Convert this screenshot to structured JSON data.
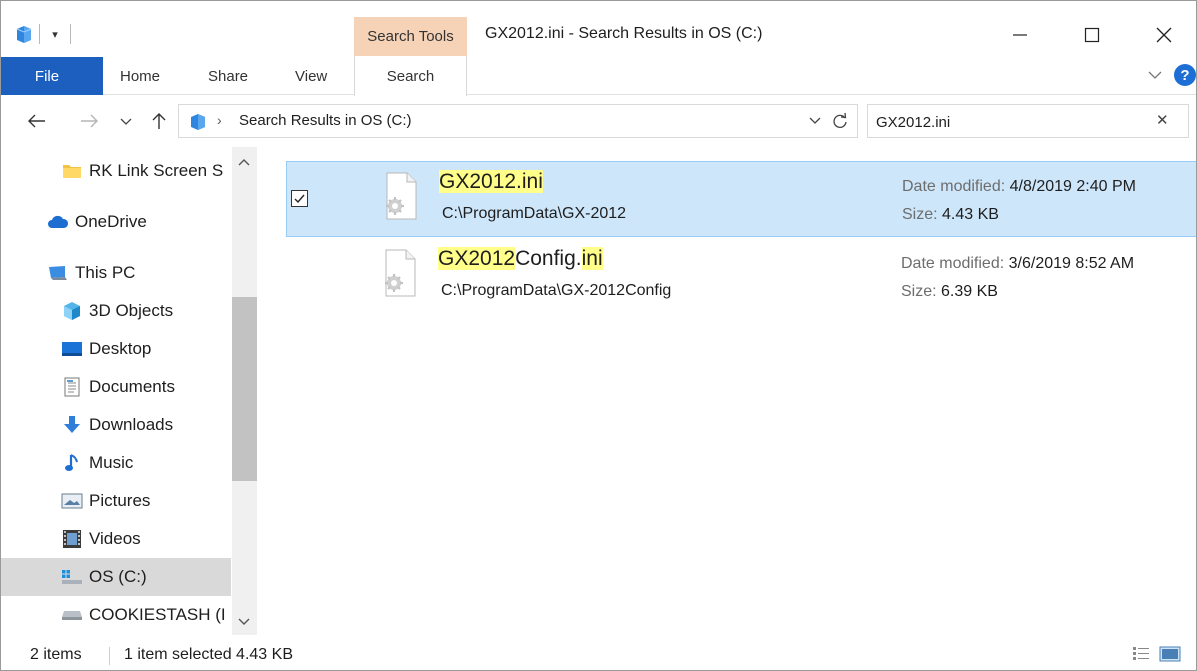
{
  "window": {
    "title": "GX2012.ini - Search Results in OS (C:)",
    "context_tab": "Search Tools"
  },
  "ribbon": {
    "tabs": [
      "File",
      "Home",
      "Share",
      "View",
      "Search"
    ],
    "active_tab": "Search",
    "file_color": "#1d5fbf",
    "context_color": "#f6d3b7"
  },
  "address": {
    "path": "Search Results in OS (C:)",
    "search_value": "GX2012.ini",
    "search_placeholder": "Search"
  },
  "navpane": {
    "items": [
      {
        "label": "RK Link Screen S",
        "icon": "folder-icon"
      },
      {
        "label": "OneDrive",
        "icon": "onedrive-icon"
      },
      {
        "label": "This PC",
        "icon": "computer-icon"
      },
      {
        "label": "3D Objects",
        "icon": "cube-icon"
      },
      {
        "label": "Desktop",
        "icon": "desktop-icon"
      },
      {
        "label": "Documents",
        "icon": "documents-icon"
      },
      {
        "label": "Downloads",
        "icon": "download-icon"
      },
      {
        "label": "Music",
        "icon": "music-icon"
      },
      {
        "label": "Pictures",
        "icon": "pictures-icon"
      },
      {
        "label": "Videos",
        "icon": "videos-icon"
      },
      {
        "label": "OS (C:)",
        "icon": "drive-os-icon"
      },
      {
        "label": "COOKIESTASH (I",
        "icon": "drive-icon"
      }
    ],
    "selected": "OS (C:)"
  },
  "results": [
    {
      "name_parts": [
        {
          "text": "GX2012.ini",
          "hl": true
        }
      ],
      "path": "C:\\ProgramData\\GX-2012",
      "date_label": "Date modified:",
      "date_value": "4/8/2019 2:40 PM",
      "size_label": "Size:",
      "size_value": "4.43 KB",
      "selected": true
    },
    {
      "name_parts": [
        {
          "text": "GX2012",
          "hl": true
        },
        {
          "text": "Config.",
          "hl": false
        },
        {
          "text": "ini",
          "hl": true
        }
      ],
      "path": "C:\\ProgramData\\GX-2012Config",
      "date_label": "Date modified:",
      "date_value": "3/6/2019 8:52 AM",
      "size_label": "Size:",
      "size_value": "6.39 KB",
      "selected": false
    }
  ],
  "status": {
    "items_count": "2 items",
    "selection": "1 item selected  4.43 KB"
  }
}
